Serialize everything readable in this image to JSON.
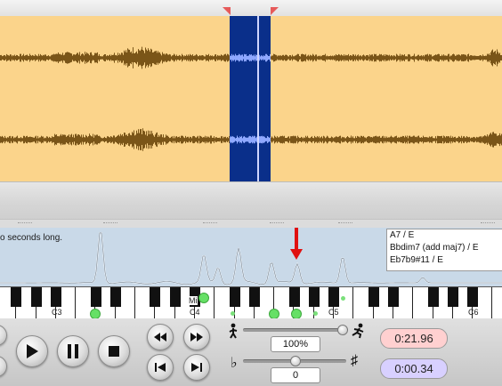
{
  "spectrum": {
    "duration_text": "o seconds long."
  },
  "chords": [
    "A7 / E",
    "Bbdim7 (add maj7) / E",
    "Eb7b9#11 / E"
  ],
  "keyboard": {
    "octave_labels": [
      "C3",
      "C4",
      "C5",
      "C6"
    ],
    "marker_label": "Mi"
  },
  "transport": {
    "speed_value": "100%",
    "pitch_value": "0",
    "flat_glyph": "♭",
    "sharp_glyph": "♯",
    "current_time": "0:21.96",
    "selection_time": "0:00.34"
  },
  "icons": {
    "rewind": "rewind-icon",
    "play": "play-icon",
    "pause": "pause-icon",
    "stop": "stop-icon",
    "fast_rewind": "fast-rewind-icon",
    "fast_forward": "fast-forward-icon",
    "skip_back": "skip-back-icon",
    "skip_forward": "skip-forward-icon",
    "walker": "walker-icon",
    "runner": "runner-icon"
  },
  "colors": {
    "waveform_bg": "#fbd48b",
    "waveform_fg": "#7a5518",
    "selection": "#0a2f8a",
    "spectrum_bg": "#c9d9e8",
    "note_dot": "#66e066",
    "time_current_bg": "#ffd0d0",
    "time_selection_bg": "#d8d0ff",
    "peak_arrow": "#e01010"
  }
}
